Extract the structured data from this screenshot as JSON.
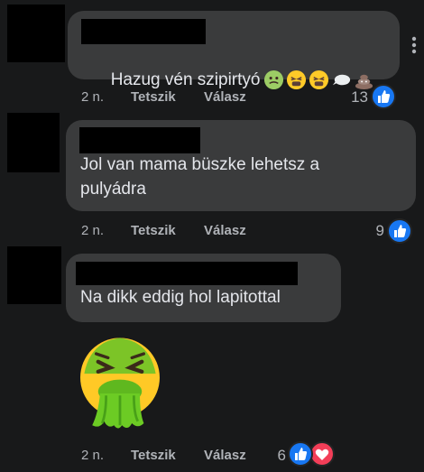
{
  "comments": [
    {
      "text": "Hazug vén szipirtyó",
      "emojis": [
        "nauseated-face-emoji",
        "tired-face-emoji",
        "tired-face-emoji",
        "speech-bubble-emoji",
        "pile-of-poo-emoji"
      ],
      "age": "2 n.",
      "like_label": "Tetszik",
      "reply_label": "Válasz",
      "reaction_count": "13",
      "reactions": [
        "like"
      ]
    },
    {
      "text": "Jol van mama büszke lehetsz a\npulyádra",
      "age": "2 n.",
      "like_label": "Tetszik",
      "reply_label": "Válasz",
      "reaction_count": "9",
      "reactions": [
        "like"
      ]
    },
    {
      "text": "Na dikk eddig hol lapitottal",
      "sticker": "vomiting-face-emoji",
      "age": "2 n.",
      "like_label": "Tetszik",
      "reply_label": "Válasz",
      "reaction_count": "6",
      "reactions": [
        "like",
        "love"
      ]
    }
  ],
  "colors": {
    "background": "#18191a",
    "bubble": "#3a3b3c",
    "like_blue": "#1877f2",
    "love_red": "#f33e58",
    "meta_text": "#b0b3b8"
  }
}
